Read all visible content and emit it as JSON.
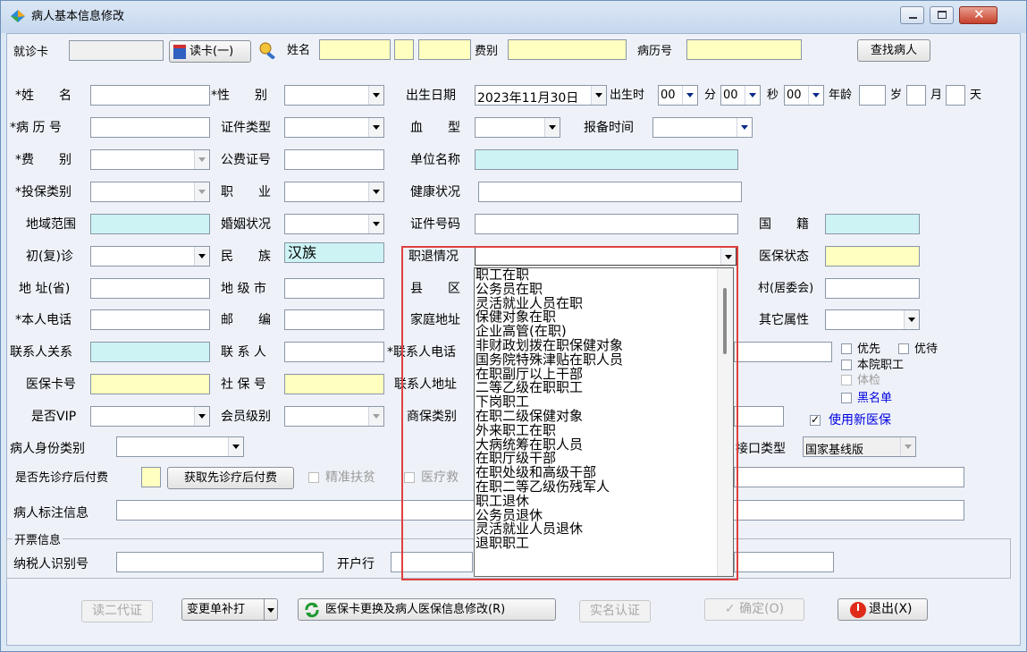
{
  "window": {
    "title": "病人基本信息修改"
  },
  "topbar": {
    "card_label": "就诊卡",
    "read_card_btn": "读卡(一)",
    "name_label": "姓名",
    "fee_label": "费别",
    "record_label": "病历号",
    "search_btn": "查找病人"
  },
  "form": {
    "name": "*姓　　名",
    "sex": "*性　　别",
    "birth_date": "出生日期",
    "birth_date_value": "2023年11月30日",
    "birth_time": "出生时",
    "hour_value": "00",
    "minute": "分",
    "minute_value": "00",
    "second": "秒",
    "second_value": "00",
    "age": "年龄",
    "age_year": "岁",
    "age_month": "月",
    "age_day": "天",
    "record_no": "*病 历 号",
    "id_type": "证件类型",
    "blood_type": "血　　型",
    "report_time": "报备时间",
    "fee_type": "*费　　别",
    "public_fee_no": "公费证号",
    "work_unit": "单位名称",
    "insure_type": "*投保类别",
    "occupation": "职　　业",
    "health": "健康状况",
    "region": "地域范围",
    "marital": "婚姻状况",
    "id_no": "证件号码",
    "nationality": "国　　籍",
    "first_visit": "初(复)诊",
    "ethnicity": "民　　族",
    "ethnicity_value": "汉族",
    "retire_status": "职退情况",
    "insurance_status": "医保状态",
    "addr_province": "地 址(省)",
    "addr_city": "地 级 市",
    "county": "县　　区",
    "village": "村(居委会)",
    "phone": "*本人电话",
    "postcode": "邮　　编",
    "home_addr": "家庭地址",
    "other_attr": "其它属性",
    "contact_rel": "联系人关系",
    "contact": "联 系 人",
    "contact_phone": "*联系人电话",
    "priority": "优先",
    "preferential": "优待",
    "staff": "本院职工",
    "physical": "体检",
    "blacklist": "黑名单",
    "new_insurance": "使用新医保",
    "insurance_card": "医保卡号",
    "social_no": "社 保 号",
    "contact_addr": "联系人地址",
    "vip": "是否VIP",
    "member_level": "会员级别",
    "commercial_type": "商保类别",
    "identity_type": "病人身份类别",
    "interface_type": "接口类型",
    "interface_value": "国家基线版",
    "pay_after": "是否先诊疗后付费",
    "get_pay_after": "获取先诊疗后付费",
    "poverty": "精准扶贫",
    "medical_aid": "医疗救",
    "annotation": "病人标注信息"
  },
  "invoice": {
    "legend": "开票信息",
    "taxpayer_id": "纳税人识别号",
    "bank": "开户行"
  },
  "footer": {
    "read_id": "读二代证",
    "change_print": "变更单补打",
    "card_change": "医保卡更换及病人医保信息修改(R)",
    "real_name": "实名认证",
    "confirm": "确定(O)",
    "exit": "退出(X)"
  },
  "dropdown": {
    "items": [
      "职工在职",
      "公务员在职",
      "灵活就业人员在职",
      "保健对象在职",
      "企业高管(在职)",
      "非财政划拨在职保健对象",
      "国务院特殊津贴在职人员",
      "在职副厅以上干部",
      "二等乙级在职职工",
      "下岗职工",
      "在职二级保健对象",
      "外来职工在职",
      "大病统筹在职人员",
      "在职厅级干部",
      "在职处级和高级干部",
      "在职二等乙级伤残军人",
      "职工退休",
      "公务员退休",
      "灵活就业人员退休",
      "退职职工"
    ]
  },
  "colors": {
    "highlight_box": "#e04040",
    "required_yellow": "#ffffbf",
    "readonly_cyan": "#cdf3f4"
  }
}
